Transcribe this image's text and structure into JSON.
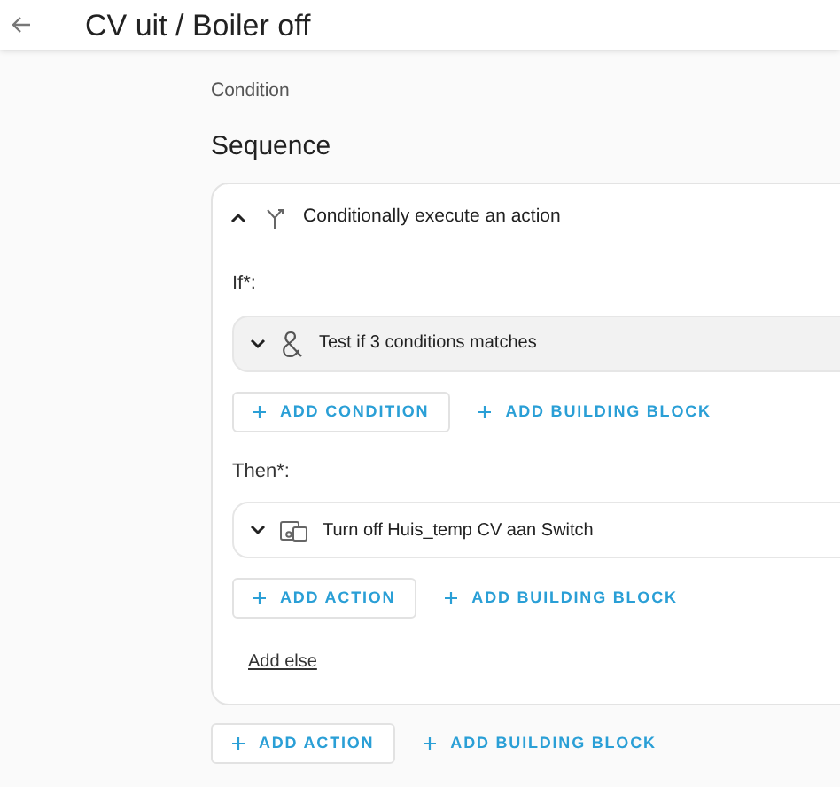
{
  "header": {
    "title": "CV uit / Boiler off"
  },
  "section_label": "Condition",
  "sequence_title": "Sequence",
  "block": {
    "title": "Conditionally execute an action",
    "expanded": true,
    "parts": [
      {
        "label": "If*:",
        "items": [
          {
            "kind": "condition",
            "title": "Test if 3 conditions matches",
            "expanded": false
          }
        ],
        "buttons": [
          {
            "kind": "outlined",
            "label": "ADD CONDITION"
          },
          {
            "kind": "text",
            "label": "ADD BUILDING BLOCK"
          }
        ]
      },
      {
        "label": "Then*:",
        "items": [
          {
            "kind": "action",
            "title": "Turn off Huis_temp CV aan Switch",
            "expanded": false
          }
        ],
        "buttons": [
          {
            "kind": "outlined",
            "label": "ADD ACTION"
          },
          {
            "kind": "text",
            "label": "ADD BUILDING BLOCK"
          }
        ]
      }
    ],
    "else_link": "Add else"
  },
  "buttons": [
    {
      "kind": "outlined",
      "label": "ADD ACTION"
    },
    {
      "kind": "text",
      "label": "ADD BUILDING BLOCK"
    }
  ]
}
